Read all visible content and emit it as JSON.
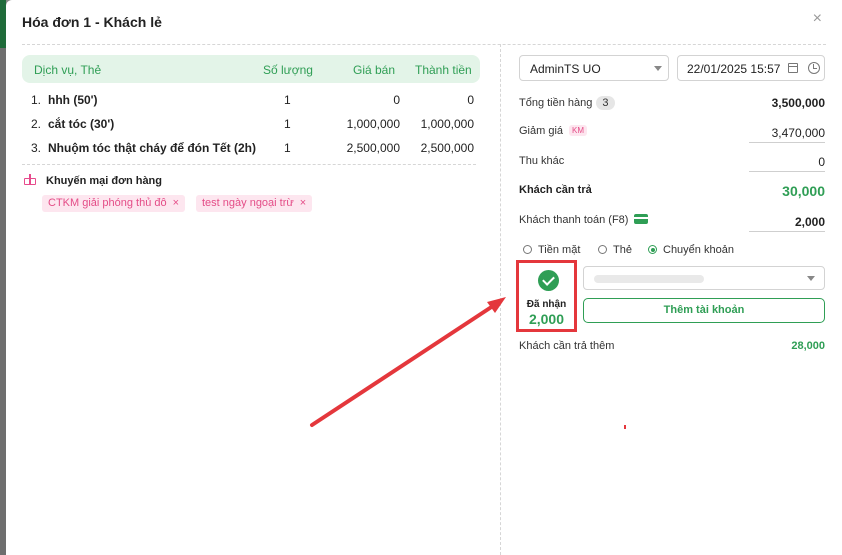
{
  "modal": {
    "title": "Hóa đơn 1 - Khách lẻ",
    "close_label": "×"
  },
  "table": {
    "headers": [
      "Dịch vụ, Thẻ",
      "Số lượng",
      "Giá bán",
      "Thành tiền"
    ],
    "rows": [
      {
        "idx": "1.",
        "name": "hhh (50')",
        "qty": "1",
        "price": "0",
        "total": "0"
      },
      {
        "idx": "2.",
        "name": "cắt tóc (30')",
        "qty": "1",
        "price": "1,000,000",
        "total": "1,000,000"
      },
      {
        "idx": "3.",
        "name": "Nhuộm tóc thật cháy để đón Tết (2h)",
        "qty": "1",
        "price": "2,500,000",
        "total": "2,500,000"
      }
    ]
  },
  "promotions": {
    "title": "Khuyến mại đơn hàng",
    "items": [
      "CTKM giải phóng thủ đô",
      "test ngày ngoại trừ"
    ],
    "remove_label": "×"
  },
  "payment": {
    "staff": "AdminTS UO",
    "datetime": "22/01/2025 15:57",
    "total_label": "Tổng tiền hàng",
    "total_count": "3",
    "total_value": "3,500,000",
    "discount_label": "Giảm giá",
    "discount_tag": "KM",
    "discount_value": "3,470,000",
    "other_label": "Thu khác",
    "other_value": "0",
    "due_label": "Khách cần trả",
    "due_value": "30,000",
    "paid_label": "Khách thanh toán (F8)",
    "paid_value": "2,000",
    "methods": [
      "Tiền mặt",
      "Thẻ",
      "Chuyển khoản"
    ],
    "selected_method": "Chuyển khoản",
    "received_label": "Đã nhận",
    "received_value": "2,000",
    "add_account_label": "Thêm tài khoản",
    "remaining_label": "Khách cần trả thêm",
    "remaining_value": "28,000"
  },
  "colors": {
    "accent": "#2f9e55",
    "highlight": "#e4373c",
    "promo": "#e44c87"
  }
}
